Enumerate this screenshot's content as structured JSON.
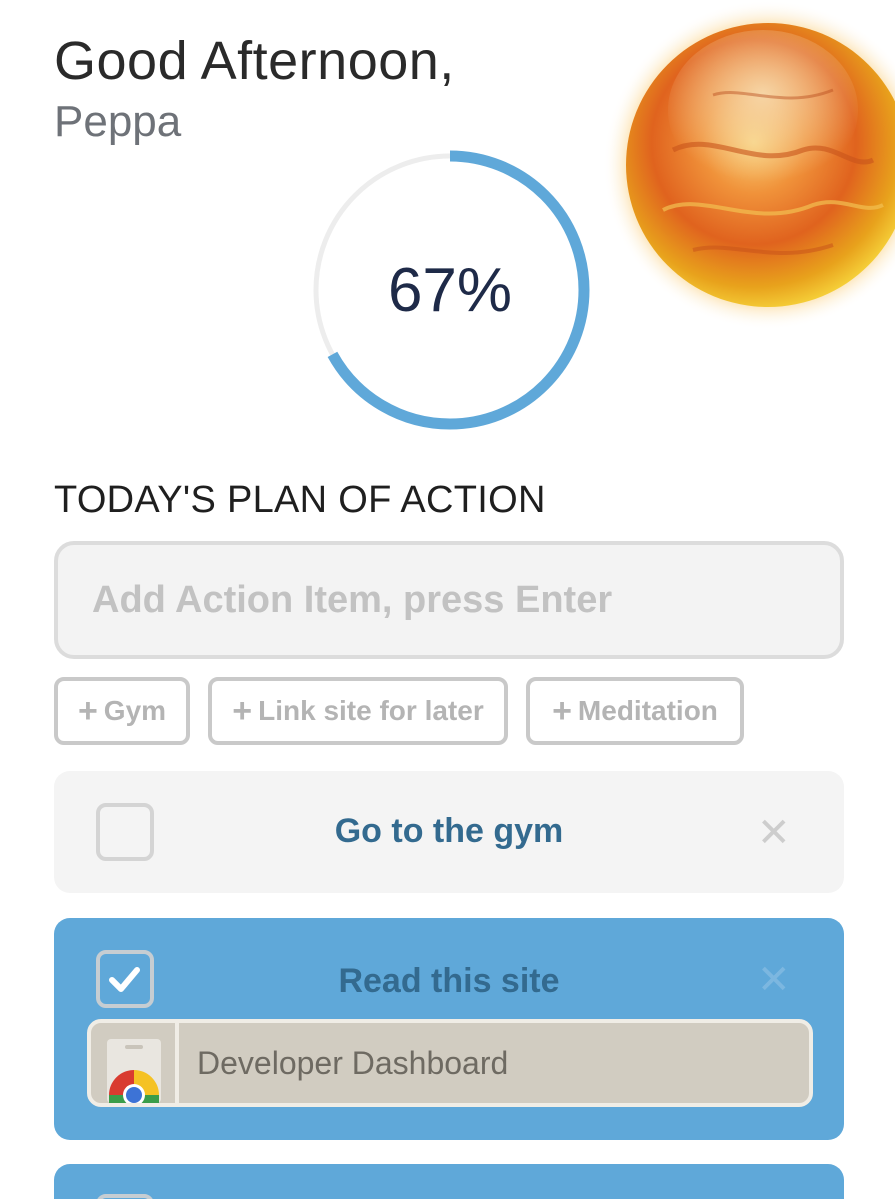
{
  "greeting": {
    "line1": "Good Afternoon,",
    "name": "Peppa"
  },
  "progress": {
    "value": 0.67,
    "label": "67%",
    "color": "#5fa8d9",
    "track_color": "#ededed"
  },
  "plan": {
    "title": "TODAY'S PLAN OF ACTION",
    "input_placeholder": "Add Action Item, press Enter",
    "quick_add": [
      {
        "label": "Gym"
      },
      {
        "label": "Link site for later"
      },
      {
        "label": "Meditation"
      }
    ],
    "tasks": [
      {
        "title": "Go to the gym",
        "checked": false
      },
      {
        "title": "Read this site",
        "checked": true,
        "link_title": "Developer Dashboard",
        "link_icon": "chrome-icon"
      }
    ]
  },
  "icons": {
    "plus": "+",
    "close": "✕",
    "check": "✓",
    "weather": "sun-icon"
  }
}
